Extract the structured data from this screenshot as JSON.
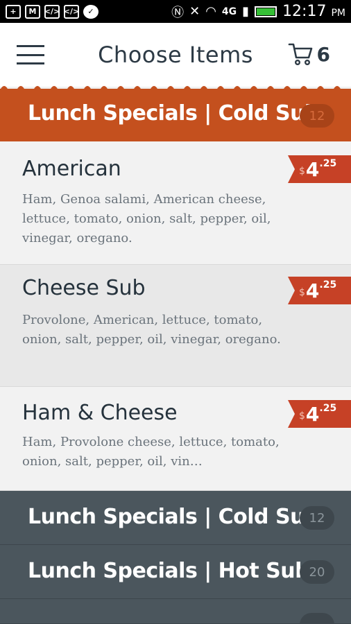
{
  "status_bar": {
    "time": "12:17",
    "ampm": "PM",
    "network": "4G"
  },
  "app_bar": {
    "title": "Choose Items",
    "cart_count": "6"
  },
  "active_section": {
    "title": "Lunch Specials | Cold Subs",
    "count": "12"
  },
  "items": [
    {
      "name": "American",
      "description": "Ham, Genoa salami, American cheese, lettuce, tomato, onion, salt, pepper, oil, vinegar, oregano.",
      "price_currency": "$",
      "price_whole": "4",
      "price_cents": ".25"
    },
    {
      "name": "Cheese Sub",
      "description": "Provolone, American, lettuce, tomato, onion, salt, pepper, oil, vinegar, oregano.",
      "price_currency": "$",
      "price_whole": "4",
      "price_cents": ".25"
    },
    {
      "name": "Ham & Cheese",
      "description": "Ham, Provolone cheese, lettuce, tomato, onion, salt, pepper, oil, vin…",
      "price_currency": "$",
      "price_whole": "4",
      "price_cents": ".25"
    }
  ],
  "sections": [
    {
      "title": "Lunch Specials | Cold Subs",
      "count": "12"
    },
    {
      "title": "Lunch Specials | Hot Subs",
      "count": "20"
    },
    {
      "title": "",
      "count": ""
    }
  ],
  "colors": {
    "section_active": "#c4501e",
    "section_dark": "#4b565d",
    "price_tag": "#c64126"
  }
}
